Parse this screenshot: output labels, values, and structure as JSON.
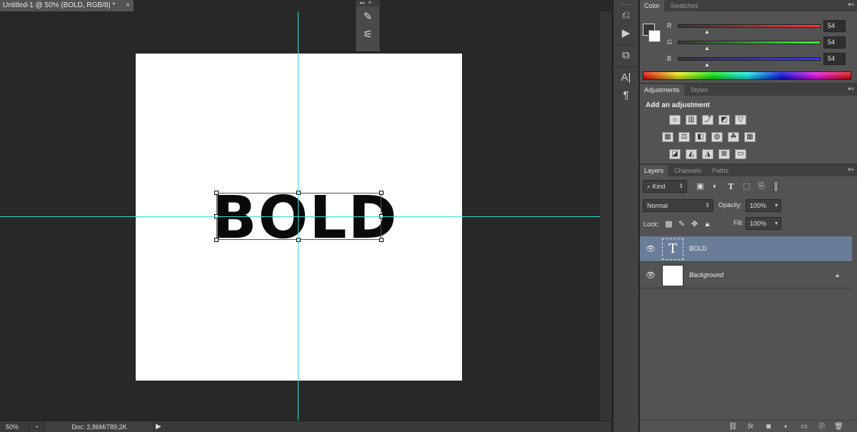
{
  "document": {
    "tab_title": "Untitled-1 @ 50% (BOLD, RGB/8) *",
    "close_glyph": "×",
    "text_content": "BOLD"
  },
  "status": {
    "zoom": "50%",
    "doc_info": "Doc: 2,86M/789,2K"
  },
  "color_panel": {
    "tabs": [
      "Color",
      "Swatches"
    ],
    "channels": [
      {
        "label": "R",
        "value": "54"
      },
      {
        "label": "G",
        "value": "54"
      },
      {
        "label": "B",
        "value": "54"
      }
    ],
    "foreground": "#363636",
    "background": "#ffffff"
  },
  "adjustments_panel": {
    "tabs": [
      "Adjustments",
      "Styles"
    ],
    "title": "Add an adjustment",
    "row1": [
      "brightness-contrast-icon",
      "levels-icon",
      "curves-icon",
      "exposure-icon",
      "vibrance-icon"
    ],
    "row2": [
      "hue-saturation-icon",
      "color-balance-icon",
      "black-white-icon",
      "photo-filter-icon",
      "channel-mixer-icon",
      "color-lookup-icon"
    ],
    "row3": [
      "invert-icon",
      "posterize-icon",
      "threshold-icon",
      "selective-color-icon",
      "gradient-map-icon"
    ]
  },
  "layers_panel": {
    "tabs": [
      "Layers",
      "Channels",
      "Paths"
    ],
    "filter_kind": "Kind",
    "blend_mode": "Normal",
    "opacity_label": "Opacity:",
    "opacity_value": "100%",
    "lock_label": "Lock:",
    "fill_label": "Fill:",
    "fill_value": "100%",
    "layers": [
      {
        "name": "BOLD",
        "type": "text",
        "selected": true,
        "thumb_glyph": "T"
      },
      {
        "name": "Background",
        "type": "pixel",
        "selected": false,
        "locked": true
      }
    ]
  }
}
